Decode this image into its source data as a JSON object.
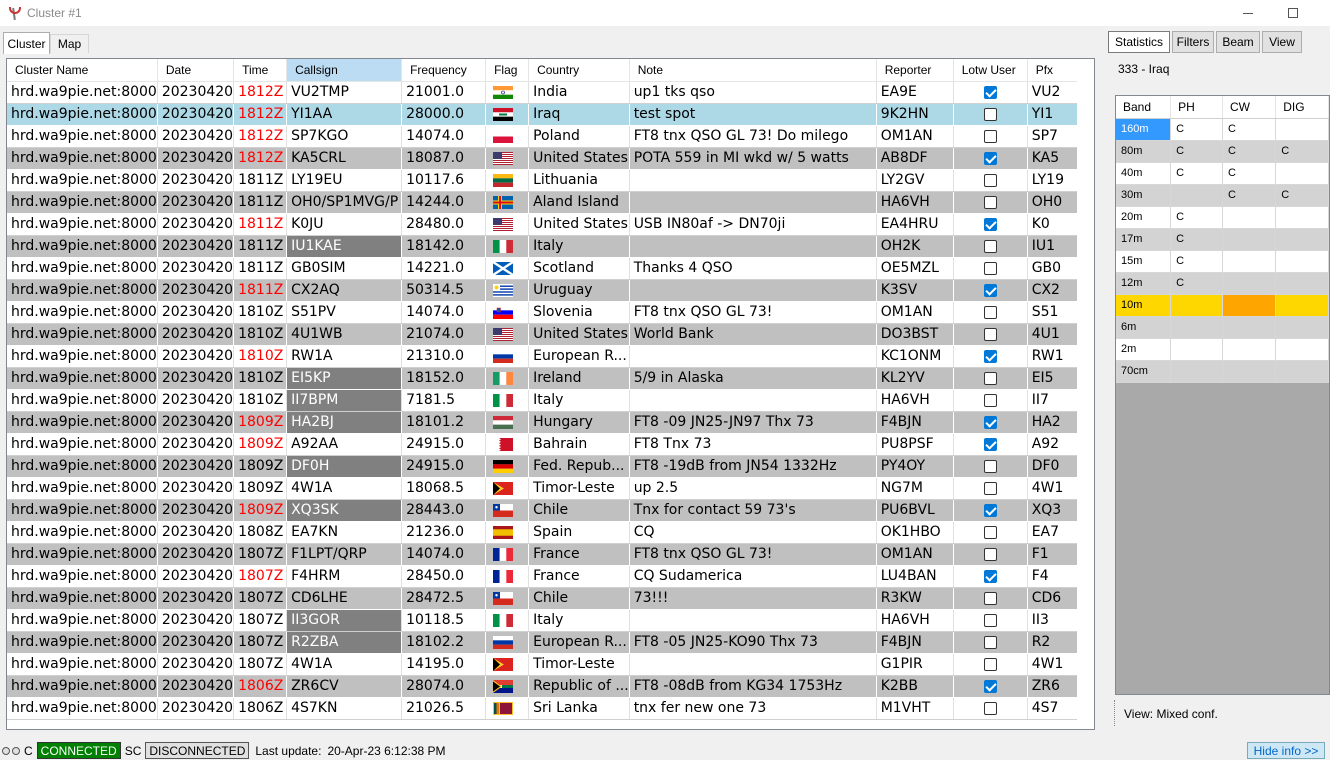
{
  "window": {
    "title": "Cluster #1"
  },
  "tabs": [
    {
      "label": "Cluster"
    },
    {
      "label": "Map"
    }
  ],
  "grid": {
    "columns": [
      "Cluster Name",
      "Date",
      "Time",
      "Callsign",
      "Frequency",
      "Flag",
      "Country",
      "Note",
      "Reporter",
      "Lotw User",
      "Pfx"
    ],
    "rows": [
      {
        "cluster": "hrd.wa9pie.net:8000",
        "date": "20230420",
        "time": "1812Z",
        "call": "VU2TMP",
        "freq": "21001.0",
        "flag": "in",
        "country": "India",
        "note": "up1 tks qso",
        "reporter": "EA9E",
        "lotw": true,
        "pfx": "VU2",
        "time_red": true,
        "call_hl": false
      },
      {
        "cluster": "hrd.wa9pie.net:8000",
        "date": "20230420",
        "time": "1812Z",
        "call": "YI1AA",
        "freq": "28000.0",
        "flag": "iq",
        "country": "Iraq",
        "note": "test spot",
        "reporter": "9K2HN",
        "lotw": false,
        "pfx": "YI1",
        "time_red": true,
        "call_hl": false
      },
      {
        "cluster": "hrd.wa9pie.net:8000",
        "date": "20230420",
        "time": "1812Z",
        "call": "SP7KGO",
        "freq": "14074.0",
        "flag": "pl",
        "country": "Poland",
        "note": "FT8 tnx QSO GL 73! Do milego",
        "reporter": "OM1AN",
        "lotw": false,
        "pfx": "SP7",
        "time_red": true,
        "call_hl": false
      },
      {
        "cluster": "hrd.wa9pie.net:8000",
        "date": "20230420",
        "time": "1812Z",
        "call": "KA5CRL",
        "freq": "18087.0",
        "flag": "us",
        "country": "United States",
        "note": "POTA 559 in MI wkd w/ 5 watts",
        "reporter": "AB8DF",
        "lotw": true,
        "pfx": "KA5",
        "time_red": true,
        "call_hl": false
      },
      {
        "cluster": "hrd.wa9pie.net:8000",
        "date": "20230420",
        "time": "1811Z",
        "call": "LY19EU",
        "freq": "10117.6",
        "flag": "lt",
        "country": "Lithuania",
        "note": "",
        "reporter": "LY2GV",
        "lotw": false,
        "pfx": "LY19",
        "time_red": false,
        "call_hl": false
      },
      {
        "cluster": "hrd.wa9pie.net:8000",
        "date": "20230420",
        "time": "1811Z",
        "call": "OH0/SP1MVG/P",
        "freq": "14244.0",
        "flag": "ax",
        "country": "Aland Island",
        "note": "",
        "reporter": "HA6VH",
        "lotw": false,
        "pfx": "OH0",
        "time_red": false,
        "call_hl": false
      },
      {
        "cluster": "hrd.wa9pie.net:8000",
        "date": "20230420",
        "time": "1811Z",
        "call": "K0JU",
        "freq": "28480.0",
        "flag": "us",
        "country": "United States",
        "note": "USB IN80af -> DN70ji",
        "reporter": "EA4HRU",
        "lotw": true,
        "pfx": "K0",
        "time_red": true,
        "call_hl": false
      },
      {
        "cluster": "hrd.wa9pie.net:8000",
        "date": "20230420",
        "time": "1811Z",
        "call": "IU1KAE",
        "freq": "18142.0",
        "flag": "it",
        "country": "Italy",
        "note": "",
        "reporter": "OH2K",
        "lotw": false,
        "pfx": "IU1",
        "time_red": false,
        "call_hl": true
      },
      {
        "cluster": "hrd.wa9pie.net:8000",
        "date": "20230420",
        "time": "1811Z",
        "call": "GB0SIM",
        "freq": "14221.0",
        "flag": "sco",
        "country": "Scotland",
        "note": "Thanks 4 QSO",
        "reporter": "OE5MZL",
        "lotw": false,
        "pfx": "GB0",
        "time_red": false,
        "call_hl": false
      },
      {
        "cluster": "hrd.wa9pie.net:8000",
        "date": "20230420",
        "time": "1811Z",
        "call": "CX2AQ",
        "freq": "50314.5",
        "flag": "uy",
        "country": "Uruguay",
        "note": "",
        "reporter": "K3SV",
        "lotw": true,
        "pfx": "CX2",
        "time_red": true,
        "call_hl": false
      },
      {
        "cluster": "hrd.wa9pie.net:8000",
        "date": "20230420",
        "time": "1810Z",
        "call": "S51PV",
        "freq": "14074.0",
        "flag": "si",
        "country": "Slovenia",
        "note": "FT8 tnx QSO GL 73!",
        "reporter": "OM1AN",
        "lotw": false,
        "pfx": "S51",
        "time_red": false,
        "call_hl": false
      },
      {
        "cluster": "hrd.wa9pie.net:8000",
        "date": "20230420",
        "time": "1810Z",
        "call": "4U1WB",
        "freq": "21074.0",
        "flag": "us",
        "country": "United States",
        "note": "World Bank",
        "reporter": "DO3BST",
        "lotw": false,
        "pfx": "4U1",
        "time_red": false,
        "call_hl": false
      },
      {
        "cluster": "hrd.wa9pie.net:8000",
        "date": "20230420",
        "time": "1810Z",
        "call": "RW1A",
        "freq": "21310.0",
        "flag": "ru",
        "country": "European R...",
        "note": "",
        "reporter": "KC1ONM",
        "lotw": true,
        "pfx": "RW1",
        "time_red": true,
        "call_hl": false
      },
      {
        "cluster": "hrd.wa9pie.net:8000",
        "date": "20230420",
        "time": "1810Z",
        "call": "EI5KP",
        "freq": "18152.0",
        "flag": "ie",
        "country": "Ireland",
        "note": "5/9 in Alaska",
        "reporter": "KL2YV",
        "lotw": false,
        "pfx": "EI5",
        "time_red": false,
        "call_hl": true
      },
      {
        "cluster": "hrd.wa9pie.net:8000",
        "date": "20230420",
        "time": "1810Z",
        "call": "II7BPM",
        "freq": "7181.5",
        "flag": "it",
        "country": "Italy",
        "note": "",
        "reporter": "HA6VH",
        "lotw": false,
        "pfx": "II7",
        "time_red": false,
        "call_hl": true
      },
      {
        "cluster": "hrd.wa9pie.net:8000",
        "date": "20230420",
        "time": "1809Z",
        "call": "HA2BJ",
        "freq": "18101.2",
        "flag": "hu",
        "country": "Hungary",
        "note": "FT8 -09 JN25-JN97 Thx 73",
        "reporter": "F4BJN",
        "lotw": true,
        "pfx": "HA2",
        "time_red": true,
        "call_hl": true
      },
      {
        "cluster": "hrd.wa9pie.net:8000",
        "date": "20230420",
        "time": "1809Z",
        "call": "A92AA",
        "freq": "24915.0",
        "flag": "bh",
        "country": "Bahrain",
        "note": "FT8  Tnx 73",
        "reporter": "PU8PSF",
        "lotw": true,
        "pfx": "A92",
        "time_red": true,
        "call_hl": false
      },
      {
        "cluster": "hrd.wa9pie.net:8000",
        "date": "20230420",
        "time": "1809Z",
        "call": "DF0H",
        "freq": "24915.0",
        "flag": "de",
        "country": "Fed. Repub...",
        "note": "FT8 -19dB from JN54 1332Hz",
        "reporter": "PY4OY",
        "lotw": false,
        "pfx": "DF0",
        "time_red": false,
        "call_hl": true
      },
      {
        "cluster": "hrd.wa9pie.net:8000",
        "date": "20230420",
        "time": "1809Z",
        "call": "4W1A",
        "freq": "18068.5",
        "flag": "tl",
        "country": "Timor-Leste",
        "note": "up 2.5",
        "reporter": "NG7M",
        "lotw": false,
        "pfx": "4W1",
        "time_red": false,
        "call_hl": false
      },
      {
        "cluster": "hrd.wa9pie.net:8000",
        "date": "20230420",
        "time": "1809Z",
        "call": "XQ3SK",
        "freq": "28443.0",
        "flag": "cl",
        "country": "Chile",
        "note": "Tnx for contact 59 73's",
        "reporter": "PU6BVL",
        "lotw": true,
        "pfx": "XQ3",
        "time_red": true,
        "call_hl": true
      },
      {
        "cluster": "hrd.wa9pie.net:8000",
        "date": "20230420",
        "time": "1808Z",
        "call": "EA7KN",
        "freq": "21236.0",
        "flag": "es",
        "country": "Spain",
        "note": "CQ",
        "reporter": "OK1HBO",
        "lotw": false,
        "pfx": "EA7",
        "time_red": false,
        "call_hl": false
      },
      {
        "cluster": "hrd.wa9pie.net:8000",
        "date": "20230420",
        "time": "1807Z",
        "call": "F1LPT/QRP",
        "freq": "14074.0",
        "flag": "fr",
        "country": "France",
        "note": "FT8 tnx QSO GL 73!",
        "reporter": "OM1AN",
        "lotw": false,
        "pfx": "F1",
        "time_red": false,
        "call_hl": false
      },
      {
        "cluster": "hrd.wa9pie.net:8000",
        "date": "20230420",
        "time": "1807Z",
        "call": "F4HRM",
        "freq": "28450.0",
        "flag": "fr",
        "country": "France",
        "note": "CQ Sudamerica",
        "reporter": "LU4BAN",
        "lotw": true,
        "pfx": "F4",
        "time_red": true,
        "call_hl": false
      },
      {
        "cluster": "hrd.wa9pie.net:8000",
        "date": "20230420",
        "time": "1807Z",
        "call": "CD6LHE",
        "freq": "28472.5",
        "flag": "cl",
        "country": "Chile",
        "note": "73!!!",
        "reporter": "R3KW",
        "lotw": false,
        "pfx": "CD6",
        "time_red": false,
        "call_hl": false
      },
      {
        "cluster": "hrd.wa9pie.net:8000",
        "date": "20230420",
        "time": "1807Z",
        "call": "II3GOR",
        "freq": "10118.5",
        "flag": "it",
        "country": "Italy",
        "note": "",
        "reporter": "HA6VH",
        "lotw": false,
        "pfx": "II3",
        "time_red": false,
        "call_hl": true
      },
      {
        "cluster": "hrd.wa9pie.net:8000",
        "date": "20230420",
        "time": "1807Z",
        "call": "R2ZBA",
        "freq": "18102.2",
        "flag": "ru",
        "country": "European R...",
        "note": "FT8 -05 JN25-KO90 Thx 73",
        "reporter": "F4BJN",
        "lotw": false,
        "pfx": "R2",
        "time_red": false,
        "call_hl": true
      },
      {
        "cluster": "hrd.wa9pie.net:8000",
        "date": "20230420",
        "time": "1807Z",
        "call": "4W1A",
        "freq": "14195.0",
        "flag": "tl",
        "country": "Timor-Leste",
        "note": "",
        "reporter": "G1PIR",
        "lotw": false,
        "pfx": "4W1",
        "time_red": false,
        "call_hl": false
      },
      {
        "cluster": "hrd.wa9pie.net:8000",
        "date": "20230420",
        "time": "1806Z",
        "call": "ZR6CV",
        "freq": "28074.0",
        "flag": "za",
        "country": "Republic of ...",
        "note": "FT8 -08dB from KG34 1753Hz",
        "reporter": "K2BB",
        "lotw": true,
        "pfx": "ZR6",
        "time_red": true,
        "call_hl": false
      },
      {
        "cluster": "hrd.wa9pie.net:8000",
        "date": "20230420",
        "time": "1806Z",
        "call": "4S7KN",
        "freq": "21026.5",
        "flag": "lk",
        "country": "Sri Lanka",
        "note": "tnx fer new one 73",
        "reporter": "M1VHT",
        "lotw": false,
        "pfx": "4S7",
        "time_red": false,
        "call_hl": false
      }
    ]
  },
  "right_panel": {
    "buttons": [
      "Statistics",
      "Filters",
      "Beam",
      "View"
    ],
    "info": "333 - Iraq",
    "stats_columns": [
      "Band",
      "PH",
      "CW",
      "DIG"
    ],
    "stats_rows": [
      {
        "band": "160m",
        "ph": "C",
        "cw": "C",
        "dig": ""
      },
      {
        "band": "80m",
        "ph": "C",
        "cw": "C",
        "dig": "C"
      },
      {
        "band": "40m",
        "ph": "C",
        "cw": "C",
        "dig": ""
      },
      {
        "band": "30m",
        "ph": "",
        "cw": "C",
        "dig": "C"
      },
      {
        "band": "20m",
        "ph": "C",
        "cw": "",
        "dig": ""
      },
      {
        "band": "17m",
        "ph": "C",
        "cw": "",
        "dig": ""
      },
      {
        "band": "15m",
        "ph": "C",
        "cw": "",
        "dig": ""
      },
      {
        "band": "12m",
        "ph": "C",
        "cw": "",
        "dig": ""
      },
      {
        "band": "10m",
        "ph": "",
        "cw": "",
        "dig": ""
      },
      {
        "band": "6m",
        "ph": "",
        "cw": "",
        "dig": ""
      },
      {
        "band": "2m",
        "ph": "",
        "cw": "",
        "dig": ""
      },
      {
        "band": "70cm",
        "ph": "",
        "cw": "",
        "dig": ""
      }
    ],
    "view_label": "View:  Mixed conf."
  },
  "status_bar": {
    "c_label": "C",
    "connected": "CONNECTED",
    "sc_label": "SC",
    "disconnected": "DISCONNECTED",
    "last_update_label": "Last update:",
    "last_update_value": "20-Apr-23 6:12:38 PM",
    "hide_info": "Hide info >>"
  },
  "colors": {
    "selected_row": "#add8e6",
    "alt_row": "#c0c0c0",
    "callsign_highlight": "#808080",
    "time_new": "#ff0000",
    "connected": "#008000",
    "band_selected": "#3399ff",
    "band_10m": "#ffd700",
    "band_10m_cw": "#ffa500"
  }
}
